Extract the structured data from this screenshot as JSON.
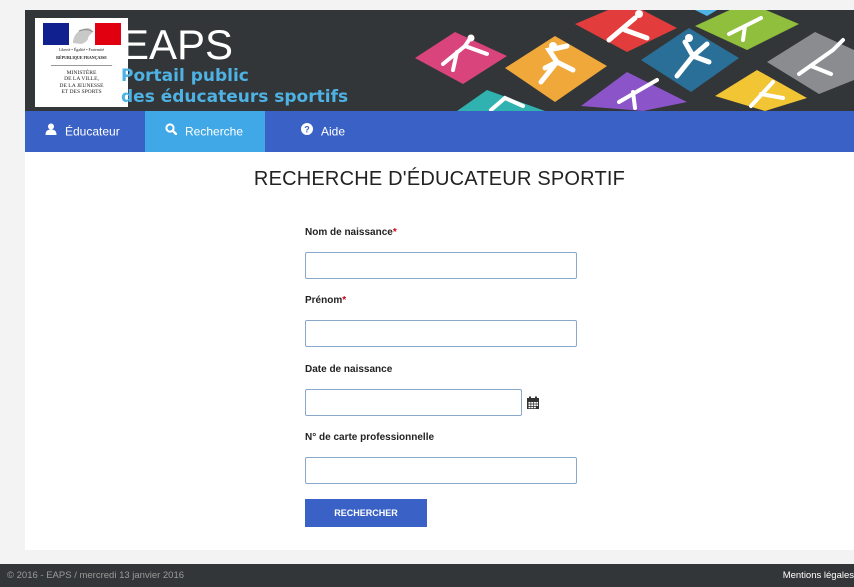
{
  "header": {
    "marianne": {
      "devise": "Liberté • Égalité • Fraternité",
      "republique": "RÉPUBLIQUE FRANÇAISE",
      "ministere_lines": [
        "MINISTÈRE",
        "DE LA VILLE,",
        "DE LA JEUNESSE",
        "ET DES SPORTS"
      ]
    },
    "title": "EAPS",
    "subtitle_line1": "Portail public",
    "subtitle_line2": "des éducateurs sportifs"
  },
  "nav": {
    "items": [
      {
        "label": "Éducateur",
        "icon": "user-icon",
        "active": false
      },
      {
        "label": "Recherche",
        "icon": "search-icon",
        "active": true
      },
      {
        "label": "Aide",
        "icon": "question-circle-icon",
        "active": false
      }
    ]
  },
  "main": {
    "title": "RECHERCHE D'ÉDUCATEUR SPORTIF",
    "fields": [
      {
        "label": "Nom de naissance",
        "required": "*",
        "value": "",
        "placeholder": ""
      },
      {
        "label": "Prénom",
        "required": "*",
        "value": "",
        "placeholder": ""
      },
      {
        "label": "Date de naissance",
        "required": "",
        "value": "",
        "placeholder": "",
        "icon": "calendar-icon"
      },
      {
        "label": "N° de carte professionnelle",
        "required": "",
        "value": "",
        "placeholder": ""
      }
    ],
    "submit_label": "RECHERCHER"
  },
  "footer": {
    "copyright": "© 2016 - EAPS / mercredi 13 janvier 2016",
    "legal_link": "Mentions légales"
  },
  "colors": {
    "header_bg": "#333638",
    "nav_bg": "#3a62c6",
    "nav_active_bg": "#41a8e7",
    "brand_accent": "#4eb2e4",
    "required": "#d0021b"
  }
}
